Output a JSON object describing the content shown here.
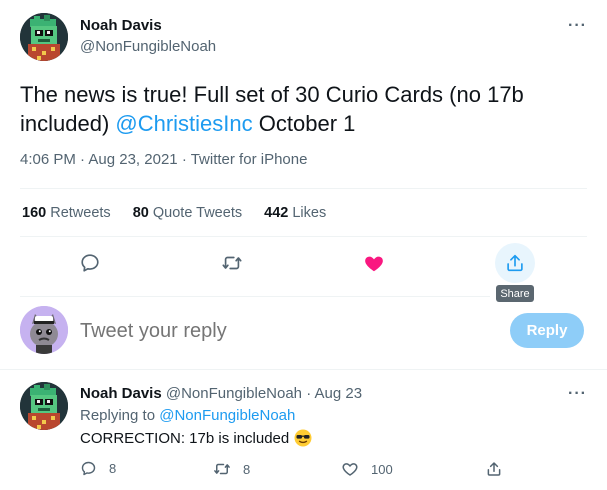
{
  "main_tweet": {
    "author_name": "Noah Davis",
    "author_handle": "@NonFungibleNoah",
    "text_before_mention": "The news is true! Full set of 30 Curio Cards (no 17b included) ",
    "mention": "@ChristiesInc",
    "text_after_mention": " October 1",
    "time": "4:06 PM",
    "date": "Aug 23, 2021",
    "source": "Twitter for iPhone",
    "more_glyph": "···"
  },
  "stats": {
    "retweets_count": "160",
    "retweets_label": "Retweets",
    "quotes_count": "80",
    "quotes_label": "Quote Tweets",
    "likes_count": "442",
    "likes_label": "Likes"
  },
  "actions": {
    "share_tooltip": "Share",
    "icons": [
      "reply-icon",
      "retweet-icon",
      "like-icon-filled",
      "share-icon"
    ],
    "like_color": "#f91880",
    "accent_color": "#1d9bf0"
  },
  "composer": {
    "placeholder": "Tweet your reply",
    "button_label": "Reply"
  },
  "reply_tweet": {
    "author_name": "Noah Davis",
    "author_handle": "@NonFungibleNoah",
    "date": "Aug 23",
    "replying_to_label": "Replying to",
    "replying_to_handle": "@NonFungibleNoah",
    "text": "CORRECTION: 17b is included",
    "emoji": "sunglasses-emoji",
    "reply_count": "8",
    "retweet_count": "8",
    "like_count": "100",
    "more_glyph": "···"
  }
}
